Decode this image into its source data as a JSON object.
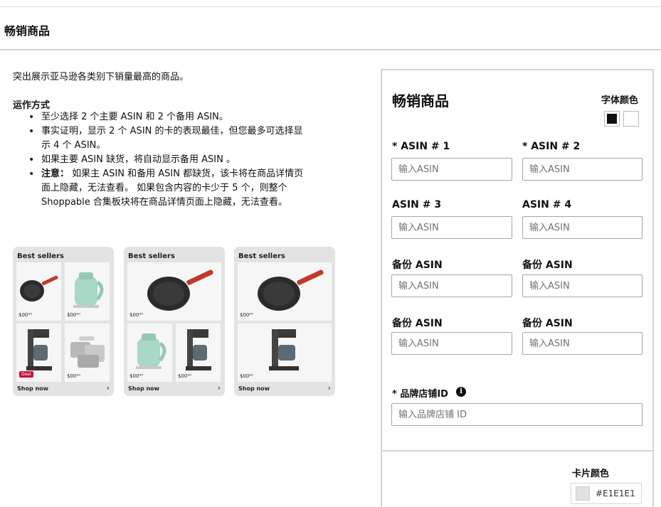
{
  "page": {
    "title": "畅销商品"
  },
  "intro": "突出展示亚马逊各类别下销量最高的商品。",
  "how_it_works": {
    "title": "运作方式",
    "bullet1": "至少选择 2 个主要 ASIN 和 2 个备用 ASIN。",
    "bullet2": "事实证明，显示 2 个 ASIN 的卡的表现最佳，但您最多可选择显示 4 个 ASIN。",
    "bullet3": "如果主要 ASIN 缺货，将自动显示备用 ASIN 。",
    "bullet4_label": "注意：",
    "bullet4_text": " 如果主 ASIN 和备用 ASIN 都缺货，该卡将在商品详情页面上隐藏，无法查看。 如果包含内容的卡少于 5 个，则整个 Shoppable 合集板块将在商品详情页面上隐藏，无法查看。"
  },
  "previews": {
    "title": "Best sellers",
    "shop_now": "Shop now",
    "price": "$00⁰⁰",
    "deal": "Deal"
  },
  "form": {
    "title": "畅销商品",
    "font_color_label": "字体颜色",
    "font_colors": [
      "#0F1111",
      "#FFFFFF"
    ],
    "asin1_label": "* ASIN # 1",
    "asin2_label": "* ASIN # 2",
    "asin3_label": "ASIN # 3",
    "asin4_label": "ASIN # 4",
    "backup_label": "备份 ASIN",
    "asin_placeholder": "输入ASIN",
    "brand_store_label": "* 品牌店铺ID",
    "brand_store_placeholder": "输入品牌店铺 ID",
    "card_color_label": "卡片颜色",
    "card_color_value": "#E1E1E1"
  }
}
